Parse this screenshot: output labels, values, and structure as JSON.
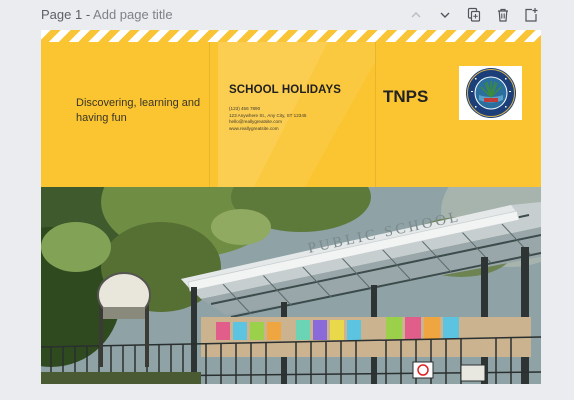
{
  "page_header": {
    "page_number": "Page 1",
    "separator": " - ",
    "title_placeholder": "Add page title",
    "icons": [
      "chevron-up-icon",
      "chevron-down-icon",
      "duplicate-page-icon",
      "delete-page-icon",
      "add-page-icon"
    ]
  },
  "design": {
    "tagline": "Discovering, learning and having fun",
    "heading": "SCHOOL HOLIDAYS",
    "contact": {
      "phone": "(123) 456 7890",
      "address": "123 Anywhere St., Any City, ST 12345",
      "email": "hello@reallygreatsite.com",
      "website": "www.reallygreatsite.com"
    },
    "brand": "TNPS",
    "photo_sign": "PUBLIC SCHOOL",
    "colors": {
      "background": "#fbc531",
      "stripe": "#ffffff",
      "canvas_bg": "#ebecf0",
      "logo_ring": "#1c3f7a"
    }
  }
}
